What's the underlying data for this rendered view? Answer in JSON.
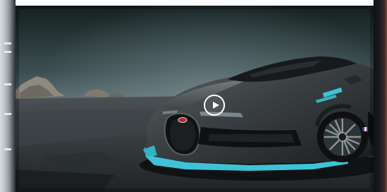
{
  "player": {
    "state": "paused",
    "play_icon": "play-icon"
  },
  "colors": {
    "sky_top": "#1c2a2e",
    "sky_mid": "#5f7378",
    "ground": "#3a3f42",
    "car_body": "#3d4244",
    "accent": "#3ec3d6"
  }
}
